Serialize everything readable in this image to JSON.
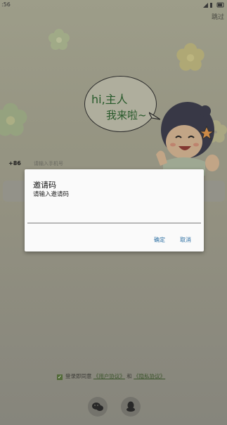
{
  "status_bar": {
    "time": ":56"
  },
  "header": {
    "skip_label": "跳过"
  },
  "bubble": {
    "line1": "hi,主人",
    "line2": "我来啦~"
  },
  "login": {
    "country_code": "+86",
    "phone_placeholder": "请输入手机号"
  },
  "agreement": {
    "prefix": "登录即同意",
    "user_agreement": "《用户协议》",
    "and": "和",
    "privacy_policy": "《隐私协议》"
  },
  "dialog": {
    "title": "邀请码",
    "hint": "请输入邀请码",
    "confirm_label": "确定",
    "cancel_label": "取消"
  },
  "social": {
    "left_icon": "wechat-icon",
    "right_icon": "qq-icon"
  }
}
